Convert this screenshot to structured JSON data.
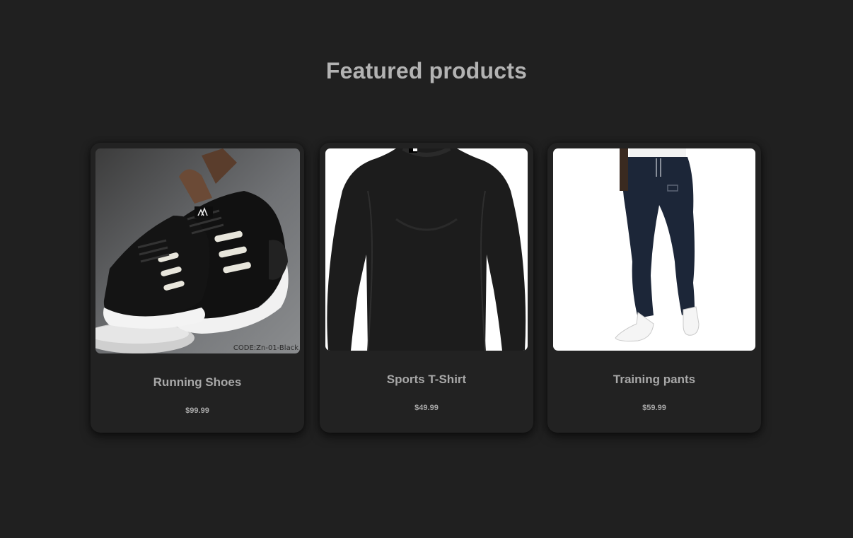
{
  "section": {
    "title": "Featured products"
  },
  "products": [
    {
      "name": "Running Shoes",
      "price": "$99.99",
      "image_icon": "running-shoes-image",
      "image_caption": "CODE:Zn-01-Black"
    },
    {
      "name": "Sports T-Shirt",
      "price": "$49.99",
      "image_icon": "sports-tshirt-image"
    },
    {
      "name": "Training pants",
      "price": "$59.99",
      "image_icon": "training-pants-image"
    }
  ],
  "colors": {
    "background": "#202020",
    "card": "#222222",
    "text": "#a8a8a8",
    "title": "#b3b3b3"
  }
}
